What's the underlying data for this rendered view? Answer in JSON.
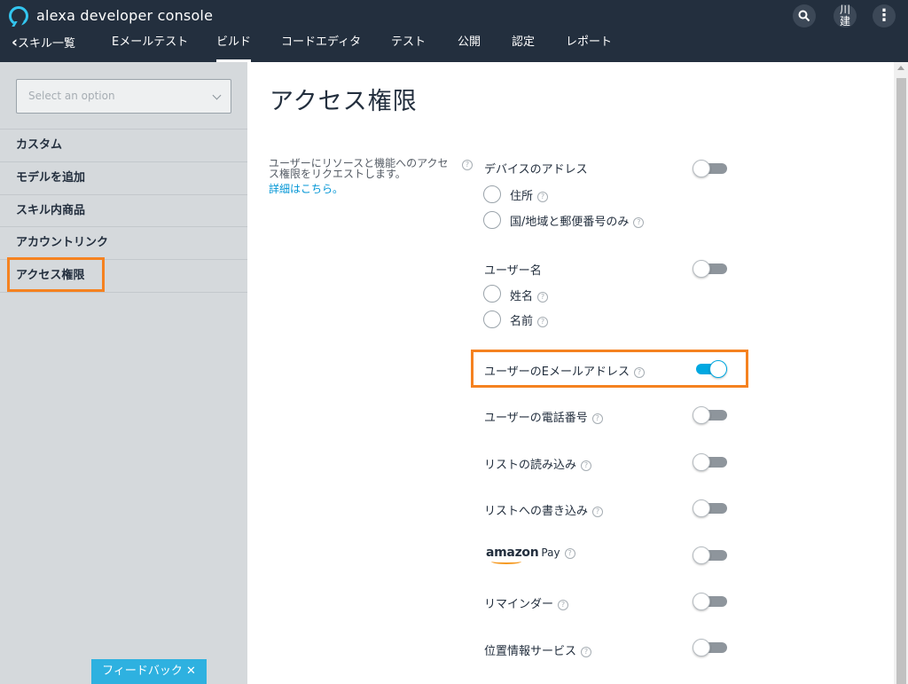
{
  "app": {
    "title": "alexa developer console"
  },
  "nav": {
    "back_label": "スキル一覧",
    "back_arrow": "‹",
    "items": [
      "Eメールテスト",
      "ビルド",
      "コードエディタ",
      "テスト",
      "公開",
      "認定",
      "レポート"
    ],
    "active": "ビルド"
  },
  "header": {
    "avatar_text": "川\n建",
    "more_glyph": "⋮"
  },
  "sidebar": {
    "select_placeholder": "Select an option",
    "items": [
      "カスタム",
      "モデルを追加",
      "スキル内商品",
      "アカウントリンク",
      "アクセス権限"
    ],
    "feedback_label": "フィードバック ✕"
  },
  "main": {
    "title": "アクセス権限",
    "description": "ユーザーにリソースと機能へのアクセス権限をリクエストします。",
    "detail_link": "詳細はこちら。",
    "help_glyph": "?",
    "permissions": {
      "device_address": {
        "label": "デバイスのアドレス",
        "enabled": false,
        "options": [
          "住所",
          "国/地域と郵便番号のみ"
        ]
      },
      "user_name": {
        "label": "ユーザー名",
        "enabled": false,
        "options": [
          "姓名",
          "名前"
        ]
      },
      "user_email": {
        "label": "ユーザーのEメールアドレス",
        "enabled": true
      },
      "user_phone": {
        "label": "ユーザーの電話番号",
        "enabled": false
      },
      "list_read": {
        "label": "リストの読み込み",
        "enabled": false
      },
      "list_write": {
        "label": "リストへの書き込み",
        "enabled": false
      },
      "amazon_pay": {
        "brand": "amazon",
        "label": "Pay",
        "enabled": false
      },
      "reminders": {
        "label": "リマインダー",
        "enabled": false
      },
      "location": {
        "label": "位置情報サービス",
        "enabled": false
      }
    }
  },
  "colors": {
    "header_bg": "#232f3e",
    "sidebar_bg": "#d5d9dc",
    "accent": "#00a8e1",
    "highlight": "#f58220",
    "link": "#0095d5"
  }
}
